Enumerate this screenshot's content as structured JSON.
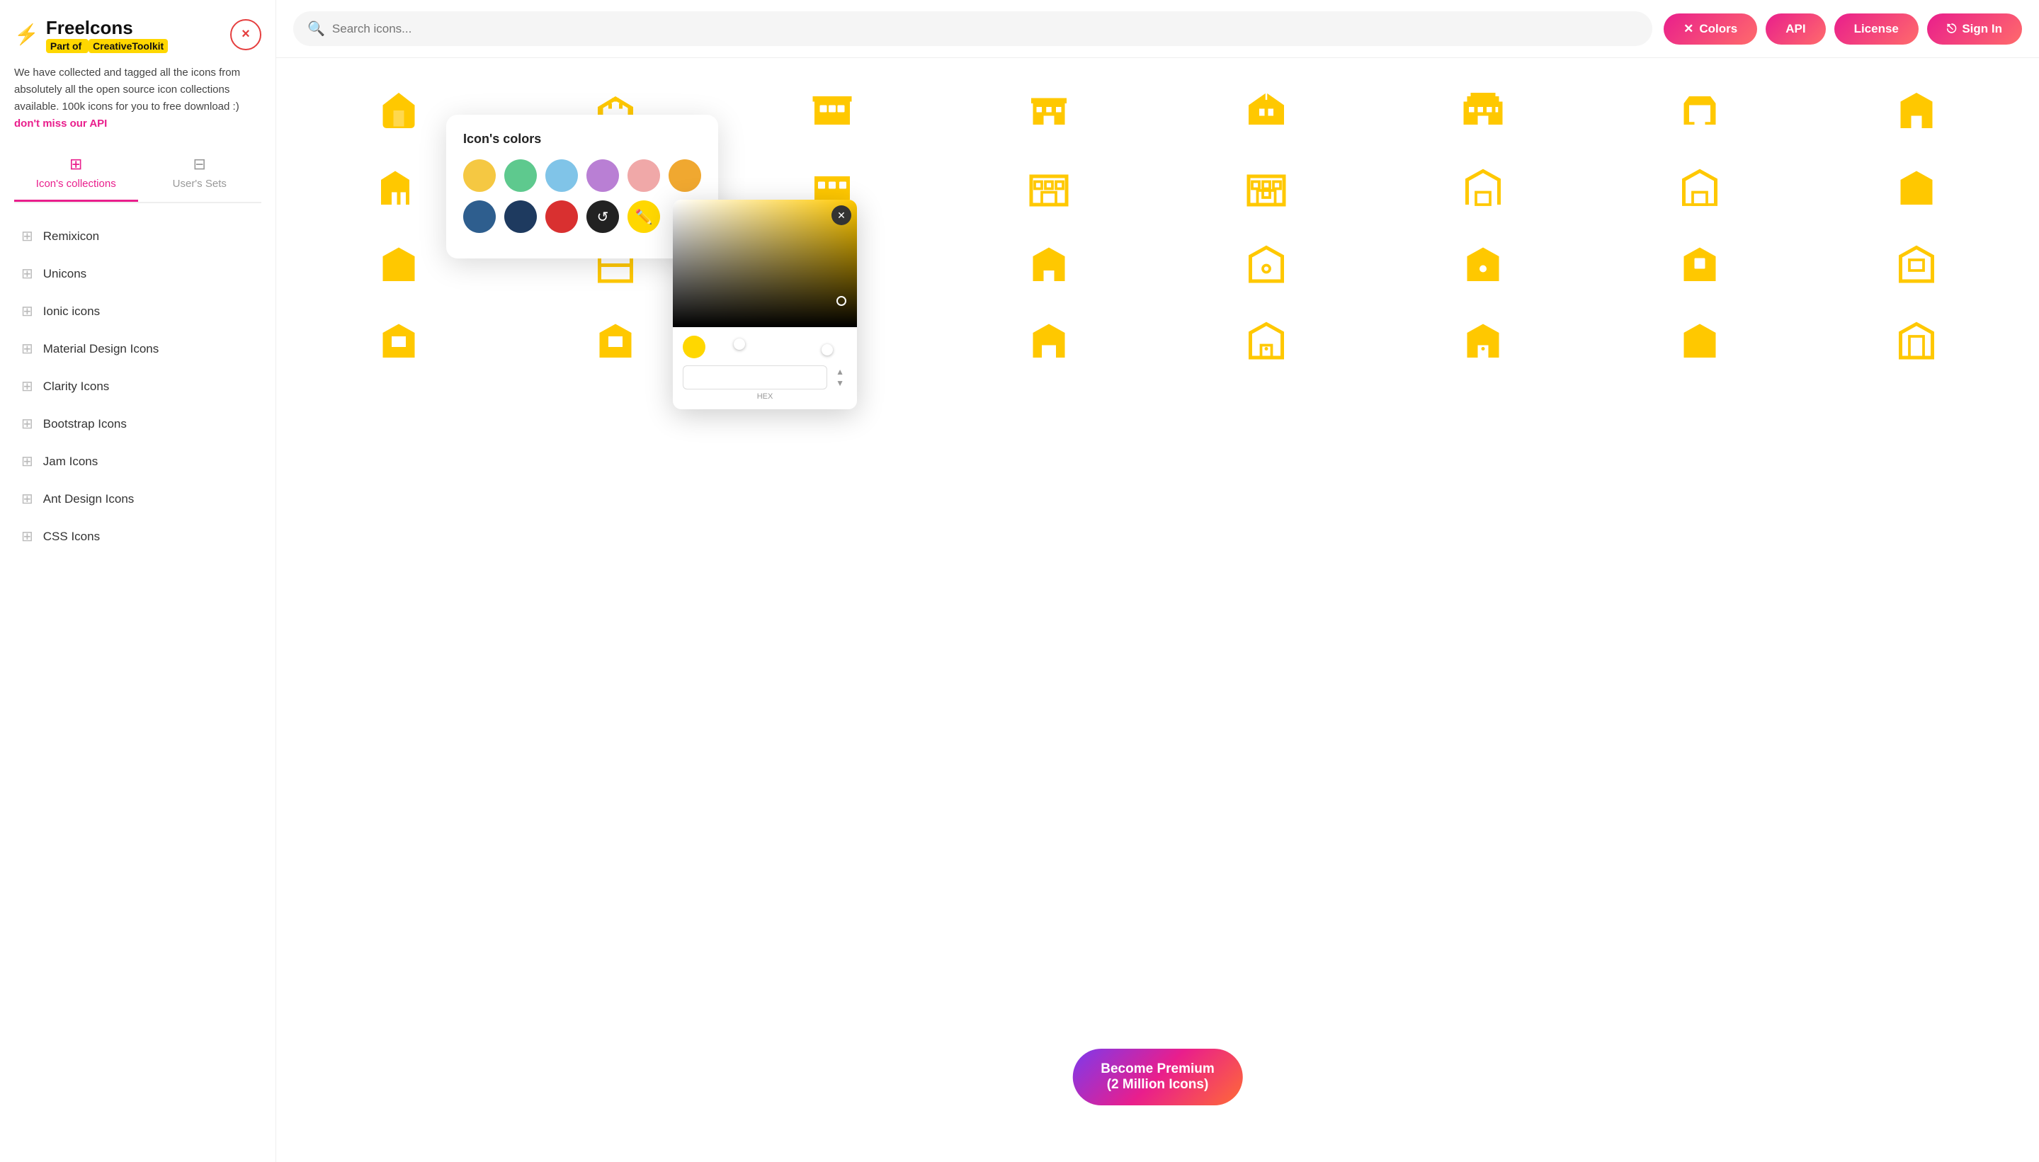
{
  "sidebar": {
    "logo": "Freelcons",
    "subtitle_prefix": "Part of ",
    "subtitle_brand": "CreativeToolkit",
    "close_label": "×",
    "description": "We have collected and tagged all the icons from absolutely all the open source icon collections available. 100k icons for you to free download :)",
    "api_link": "don't miss our API",
    "tabs": [
      {
        "id": "collections",
        "label": "Icon's collections",
        "active": true
      },
      {
        "id": "user-sets",
        "label": "User's Sets",
        "active": false
      }
    ],
    "collections": [
      {
        "id": "remixicon",
        "label": "Remixicon"
      },
      {
        "id": "unicons",
        "label": "Unicons"
      },
      {
        "id": "ionic",
        "label": "Ionic icons"
      },
      {
        "id": "material",
        "label": "Material Design Icons"
      },
      {
        "id": "clarity",
        "label": "Clarity Icons"
      },
      {
        "id": "bootstrap",
        "label": "Bootstrap Icons"
      },
      {
        "id": "jam",
        "label": "Jam Icons"
      },
      {
        "id": "ant-design",
        "label": "Ant Design Icons"
      },
      {
        "id": "css",
        "label": "CSS Icons"
      }
    ]
  },
  "header": {
    "search_placeholder": "Search icons...",
    "buttons": {
      "colors": "Colors",
      "api": "API",
      "license": "License",
      "signin": "Sign In"
    }
  },
  "color_panel": {
    "title": "Icon's colors",
    "swatches": [
      {
        "id": "yellow",
        "color": "#F5C842"
      },
      {
        "id": "green",
        "color": "#5EC98E"
      },
      {
        "id": "blue",
        "color": "#80C4E8"
      },
      {
        "id": "purple",
        "color": "#B97FD4"
      },
      {
        "id": "pink",
        "color": "#F0A8A8"
      },
      {
        "id": "orange",
        "color": "#F0A830"
      },
      {
        "id": "navy",
        "color": "#2E5E8E"
      },
      {
        "id": "dark-navy",
        "color": "#1E3A5F"
      },
      {
        "id": "red",
        "color": "#D93030"
      }
    ]
  },
  "color_picker": {
    "hex_value": "#FFC800",
    "hex_label": "HEX"
  },
  "premium_banner": {
    "line1": "Become Premium",
    "line2": "(2 Million Icons)"
  },
  "icons": {
    "accent_color": "#FFC800"
  }
}
